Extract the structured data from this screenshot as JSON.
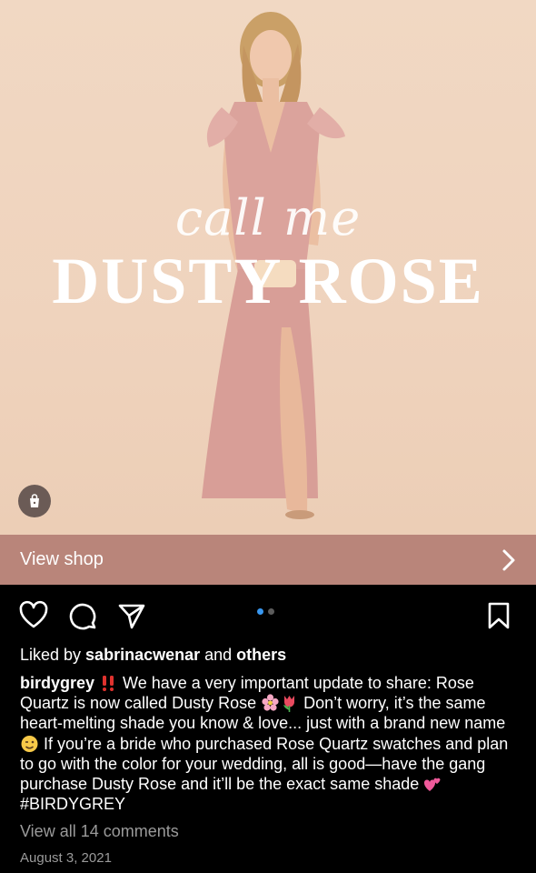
{
  "post": {
    "image": {
      "script_text": "call me",
      "headline": "DUSTY ROSE",
      "shop_tag_icon": "shopping-bag-icon"
    },
    "view_shop_label": "View shop",
    "actions": {
      "like_icon": "heart-icon",
      "comment_icon": "comment-bubble-icon",
      "share_icon": "paper-plane-icon",
      "save_icon": "bookmark-icon"
    },
    "carousel": {
      "count": 2,
      "active_index": 0
    },
    "likes": {
      "prefix": "Liked by ",
      "user": "sabrinacwenar",
      "middle": " and ",
      "others": "others"
    },
    "caption": {
      "username": "birdygrey",
      "part1": " We have a very important update to share: Rose Quartz is now called Dusty Rose ",
      "part2": "  Don’t worry, it’s the same heart-melting shade you know & love... just with a brand new name ",
      "part3": " If you’re a bride who purchased Rose Quartz swatches and plan to go with the color for your wedding, all is good—have the gang purchase Dusty Rose and it’ll be the exact same shade ",
      "part4": " #BIRDYGREY"
    },
    "view_comments": "View all 14 comments",
    "date": "August 3, 2021",
    "colors": {
      "view_shop_bg": "#b9857a",
      "photo_bg": "#f1d8c3",
      "dress": "#dba39c",
      "active_dot": "#3897f0"
    }
  }
}
